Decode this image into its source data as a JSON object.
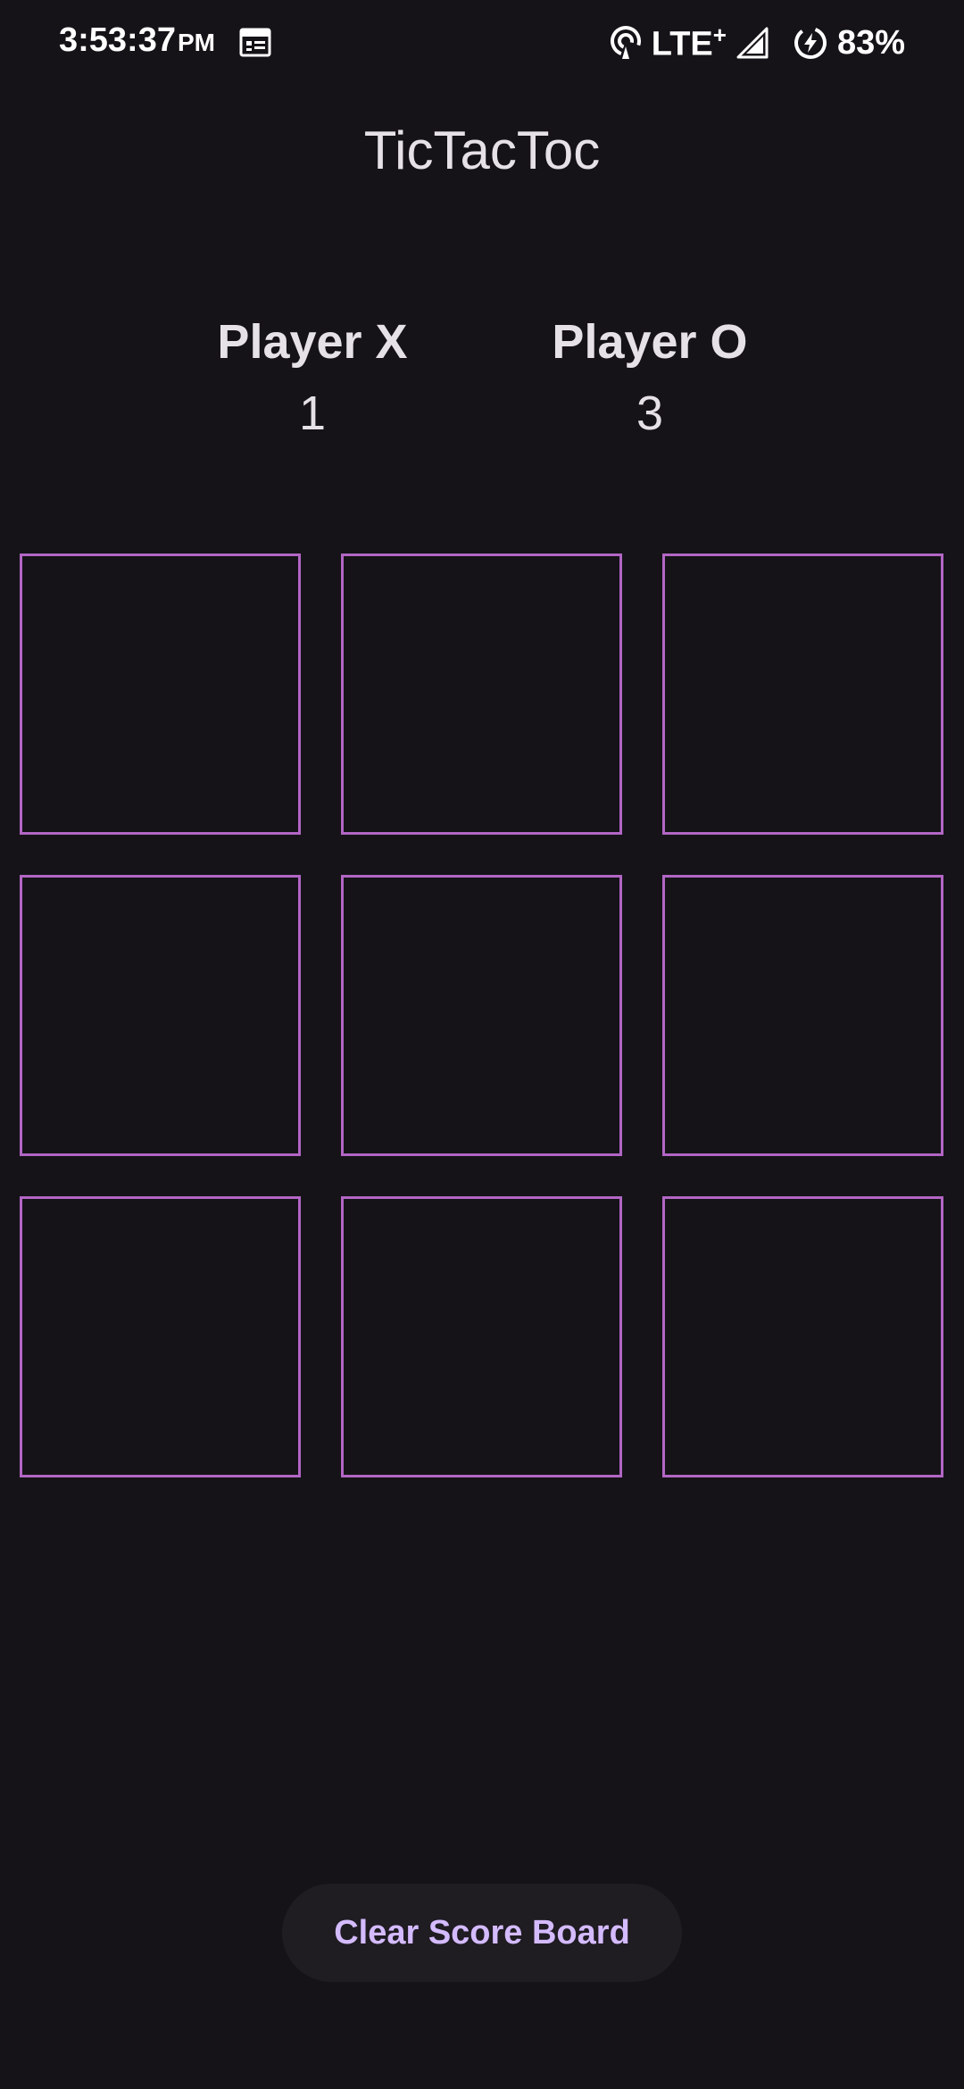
{
  "status_bar": {
    "time": "3:53:37",
    "ampm": "PM",
    "network": "LTE",
    "network_plus": "+",
    "battery": "83%",
    "icons": [
      "calendar-icon",
      "hotspot-icon",
      "signal-icon",
      "battery-saver-icon"
    ]
  },
  "app": {
    "title": "TicTacToc"
  },
  "scoreboard": {
    "player_x": {
      "label": "Player X",
      "score": "1"
    },
    "player_o": {
      "label": "Player O",
      "score": "3"
    }
  },
  "board": {
    "cells": [
      "",
      "",
      "",
      "",
      "",
      "",
      "",
      "",
      ""
    ],
    "border_color": "#b266c4"
  },
  "actions": {
    "clear_label": "Clear Score Board"
  },
  "colors": {
    "background": "#151318",
    "text": "#e6e1e6",
    "accent": "#d4bbff",
    "button_bg": "#1f1c22"
  }
}
